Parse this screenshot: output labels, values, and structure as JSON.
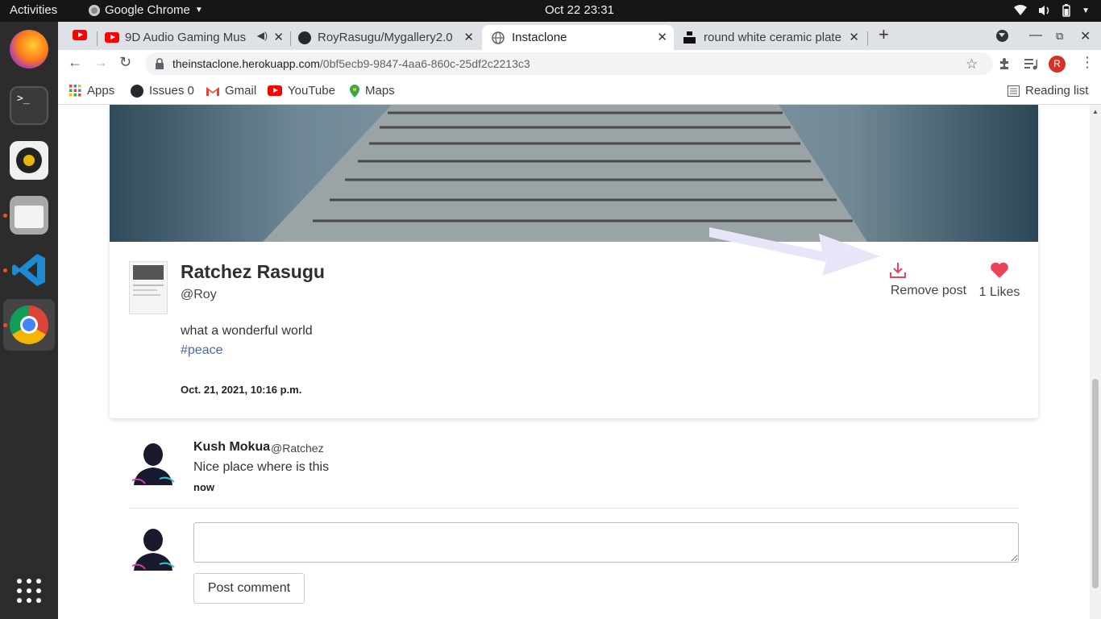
{
  "os": {
    "activities": "Activities",
    "app_menu": "Google Chrome",
    "clock": "Oct 22  23:31"
  },
  "browser": {
    "tabs": [
      {
        "title": "9D Audio Gaming Mus",
        "icon": "youtube-icon"
      },
      {
        "title": "RoyRasugu/Mygallery2.0",
        "icon": "github-icon"
      },
      {
        "title": "Instaclone",
        "icon": "globe-icon"
      },
      {
        "title": "round white ceramic plate",
        "icon": "unsplash-icon"
      }
    ],
    "url_host": "theinstaclone.herokuapp.com",
    "url_path": "/0bf5ecb9-9847-4aa6-860c-25df2c2213c3",
    "profile_initial": "R",
    "bookmarks": [
      "Apps",
      "Issues 0",
      "Gmail",
      "YouTube",
      "Maps"
    ],
    "reading_list": "Reading list"
  },
  "post": {
    "author_name": "Ratchez Rasugu",
    "author_handle": "@Roy",
    "caption": "what a wonderful world",
    "hashtag": "#peace",
    "date": "Oct. 21, 2021, 10:16 p.m.",
    "remove_label": "Remove post",
    "likes_label": "1 Likes"
  },
  "comments": [
    {
      "name": "Kush Mokua",
      "user": "@Ratchez",
      "text": "Nice place where is this",
      "time": "now"
    }
  ],
  "comment_form": {
    "button_label": "Post comment"
  },
  "colors": {
    "accent_red": "#e8445a",
    "link_blue": "#4a67b3"
  }
}
